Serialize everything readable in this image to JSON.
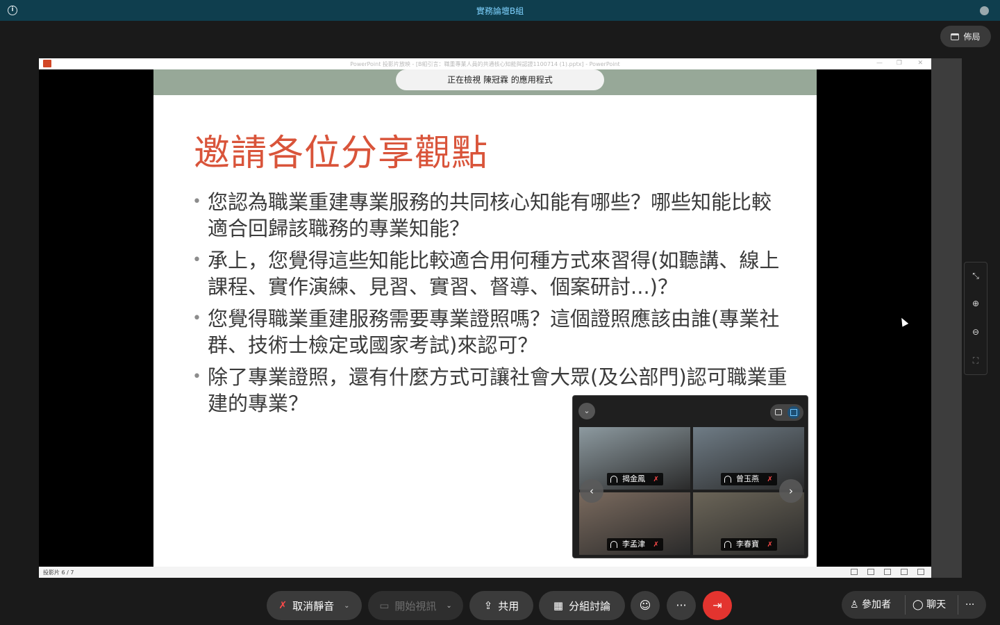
{
  "meeting": {
    "title": "實務論壇B組",
    "layout_label": "佈局"
  },
  "share": {
    "window_title": "PowerPoint 投影片放映 - [B組引言：職重專業人員的共通核心知能與認證1100714 (1).pptx] - PowerPoint",
    "viewing_banner": "正在檢視 陳冠霖 的應用程式",
    "status_left": "投影片 6 / 7"
  },
  "slide": {
    "title": "邀請各位分享觀點",
    "bullets": [
      "您認為職業重建專業服務的共同核心知能有哪些？哪些知能比較適合回歸該職務的專業知能？",
      "承上，您覺得這些知能比較適合用何種方式來習得(如聽講、線上課程、實作演練、見習、實習、督導、個案研討...)？",
      "您覺得職業重建服務需要專業證照嗎？這個證照應該由誰(專業社群、技術士檢定或國家考試)來認可？",
      "除了專業證照，還有什麼方式可讓社會大眾(及公部門)認可職業重建的專業？"
    ]
  },
  "participants": [
    {
      "name": "揭金鳳",
      "bg": "#8d9aa0"
    },
    {
      "name": "曾玉燕",
      "bg": "#6f7c86"
    },
    {
      "name": "李孟津",
      "bg": "#7a6a5e"
    },
    {
      "name": "李春寶",
      "bg": "#6b6558"
    }
  ],
  "toolbar": {
    "unmute": "取消靜音",
    "start_video": "開始視訊",
    "share": "共用",
    "breakout": "分組討論",
    "participants": "參加者",
    "chat": "聊天",
    "more": "···"
  },
  "colors": {
    "title_red": "#d9543a",
    "topbar": "#0f3e4e",
    "end_red": "#e3342f"
  }
}
